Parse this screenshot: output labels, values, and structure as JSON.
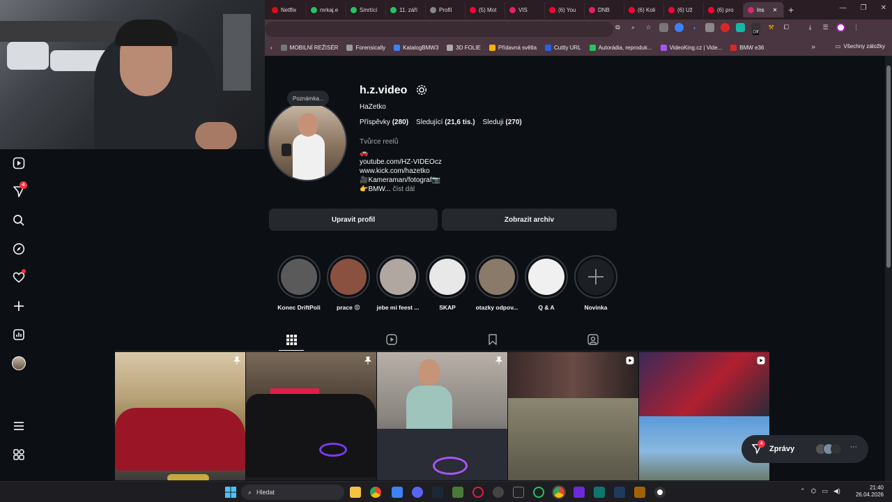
{
  "browser": {
    "tabs": [
      {
        "label": "Netflix",
        "color": "#e50914"
      },
      {
        "label": "mrkaj.e",
        "color": "#22c55e"
      },
      {
        "label": "Smrtící",
        "color": "#22c55e"
      },
      {
        "label": "11. září",
        "color": "#22c55e"
      },
      {
        "label": "Profil",
        "color": "#888888"
      },
      {
        "label": "(5) Mot",
        "color": "#ff0033"
      },
      {
        "label": "VIS",
        "color": "#e91e63"
      },
      {
        "label": "(6) You",
        "color": "#ff0033"
      },
      {
        "label": "DNB",
        "color": "#e91e63"
      },
      {
        "label": "(6) Koli",
        "color": "#ff0033"
      },
      {
        "label": "(6) Už",
        "color": "#ff0033"
      },
      {
        "label": "(6) pro",
        "color": "#ff0033"
      },
      {
        "label": "Ins",
        "color": "#d62976",
        "active": true
      }
    ],
    "new_tab": "+",
    "bookmarks": [
      {
        "label": "MOBILNÍ REŽISÉR",
        "color": "#777"
      },
      {
        "label": "Forensically",
        "color": "#999"
      },
      {
        "label": "KatalogBMW3",
        "color": "#3b82f6"
      },
      {
        "label": "3D FOLIE",
        "color": "#aaa"
      },
      {
        "label": "Přídavná světla",
        "color": "#f5b400"
      },
      {
        "label": "Cuttly URL",
        "color": "#2563eb"
      },
      {
        "label": "Autorádia, reproduk...",
        "color": "#22c55e"
      },
      {
        "label": "VideoKing.cz | Vide...",
        "color": "#a855f7"
      },
      {
        "label": "BMW e36",
        "color": "#dc2626"
      }
    ],
    "bookmarks_more": "»",
    "all_bookmarks": "Všechny záložky",
    "off_badge": "Off"
  },
  "sidebar": {
    "messages_badge": "4"
  },
  "profile": {
    "note": "Poznámka...",
    "username": "h.z.video",
    "full_name": "HaZetko",
    "stats": {
      "posts_label": "Příspěvky",
      "posts": "(280)",
      "followers_label": "Sledující",
      "followers": "(21,6 tis.)",
      "following_label": "Sleduji",
      "following": "(270)"
    },
    "category": "Tvůrce reelů",
    "bio": [
      "🚗",
      "youtube.com/HZ-VIDEOcz",
      "www.kick.com/hazetko",
      "🎥Kameraman/fotograf📷",
      "👉BMW..."
    ],
    "bio_more": "číst dál",
    "edit_button": "Upravit profil",
    "archive_button": "Zobrazit archiv"
  },
  "highlights": [
    {
      "label": "Konec DriftPoli",
      "color": "#5a5a5a"
    },
    {
      "label": "prace 😡",
      "color": "#8a5040"
    },
    {
      "label": "jebe mi feest ...",
      "color": "#b0a8a0"
    },
    {
      "label": "SKAP",
      "color": "#e8e8e8"
    },
    {
      "label": "otazky odpov...",
      "color": "#8a7a6a"
    },
    {
      "label": "Q & A",
      "color": "#f0f0f0"
    },
    {
      "label": "Novinka",
      "color": "#1c1f24"
    }
  ],
  "messages_widget": {
    "label": "Zprávy",
    "badge": "4"
  },
  "taskbar": {
    "search_placeholder": "Hledat",
    "time": "21:40",
    "date": "26.04.2026"
  }
}
